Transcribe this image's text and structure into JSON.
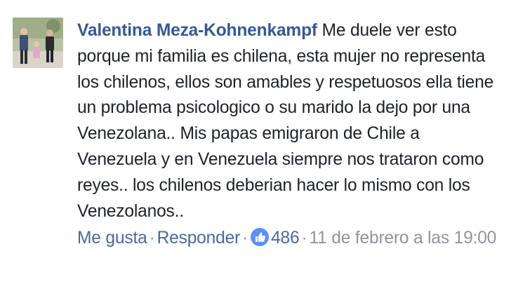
{
  "comment": {
    "author": "Valentina Meza-Kohnenkampf",
    "text": "Me duele ver esto porque mi familia es chilena, esta mujer no representa los chilenos, ellos son amables y respetuosos ella tiene un problema psicologico o su marido la dejo por una Venezolana.. Mis papas emigraron de Chile a Venezuela y en Venezuela siempre nos trataron como reyes.. los chilenos deberian hacer lo mismo con los Venezolanos..",
    "actions": {
      "like_label": "Me gusta",
      "reply_label": "Responder",
      "separator": "·",
      "like_count": "486",
      "timestamp": "11 de febrero a las 19:00"
    }
  },
  "icons": {
    "avatar": "profile-photo",
    "reaction": "thumbs-up-icon"
  },
  "colors": {
    "author": "#365899",
    "link": "#4b67a1",
    "text": "#1d2129",
    "meta": "#90949c",
    "like_badge": "#5890ff"
  }
}
